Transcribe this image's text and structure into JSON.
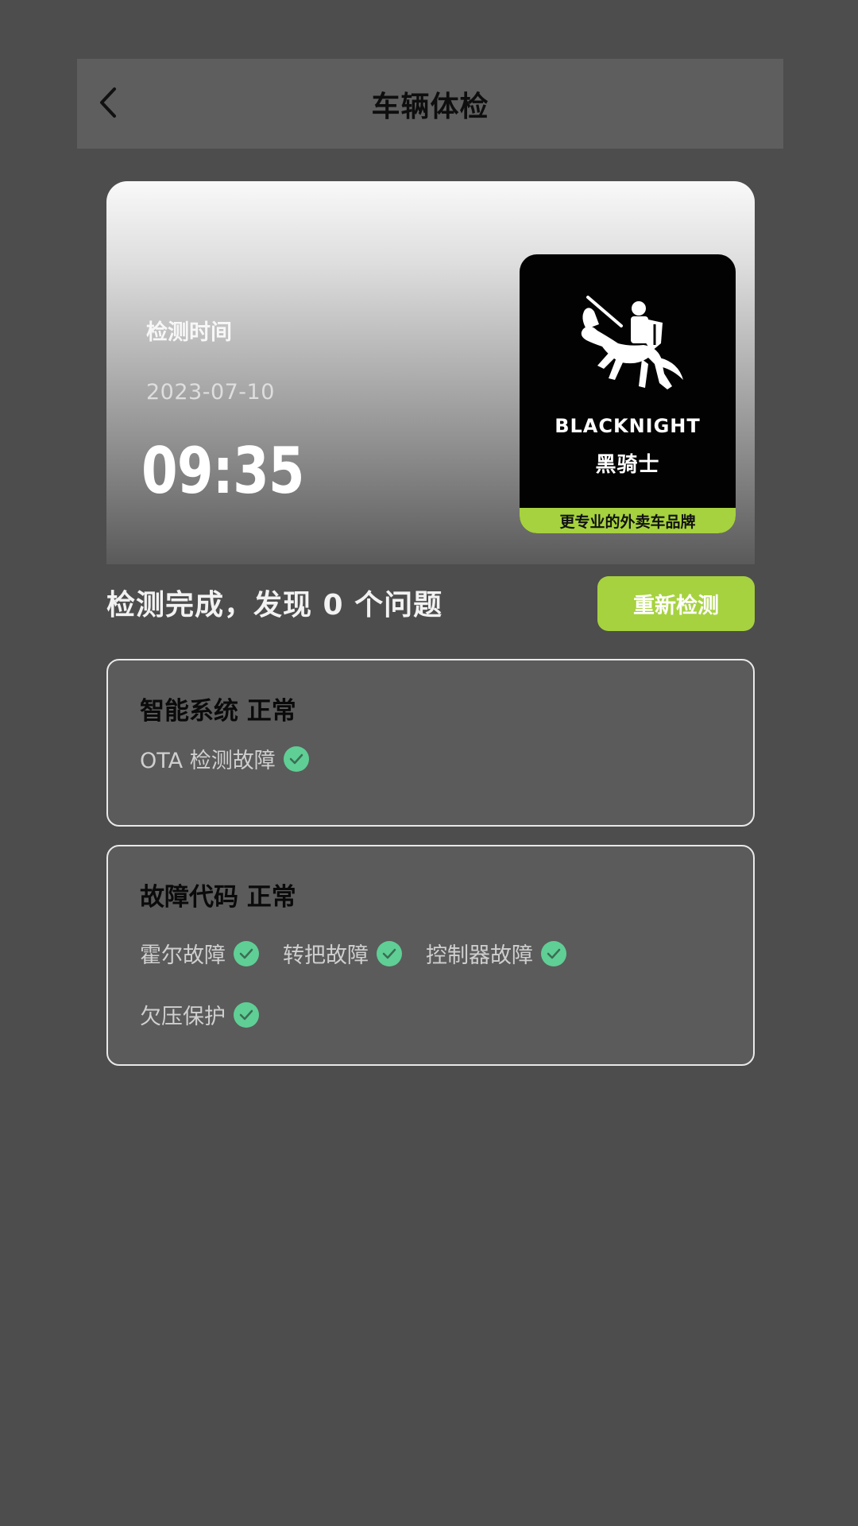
{
  "header": {
    "title": "车辆体检"
  },
  "hero": {
    "label": "检测时间",
    "date": "2023-07-10",
    "time": "09:35",
    "logo": {
      "brand_en": "BLACKNIGHT",
      "brand_cn": "黑骑士",
      "slogan": "更专业的外卖车品牌"
    }
  },
  "result": {
    "summary": "检测完成，发现 0 个问题",
    "recheck_label": "重新检测"
  },
  "panels": [
    {
      "title": "智能系统 正常",
      "items": [
        "OTA 检测故障"
      ]
    },
    {
      "title": "故障代码 正常",
      "items": [
        "霍尔故障",
        "转把故障",
        "控制器故障",
        "欠压保护"
      ]
    }
  ],
  "colors": {
    "accent": "#a6d23f",
    "check": "#5fcf95",
    "background": "#4d4d4d"
  },
  "icons": {
    "back": "chevron-left-icon",
    "status": "check-circle-icon"
  }
}
